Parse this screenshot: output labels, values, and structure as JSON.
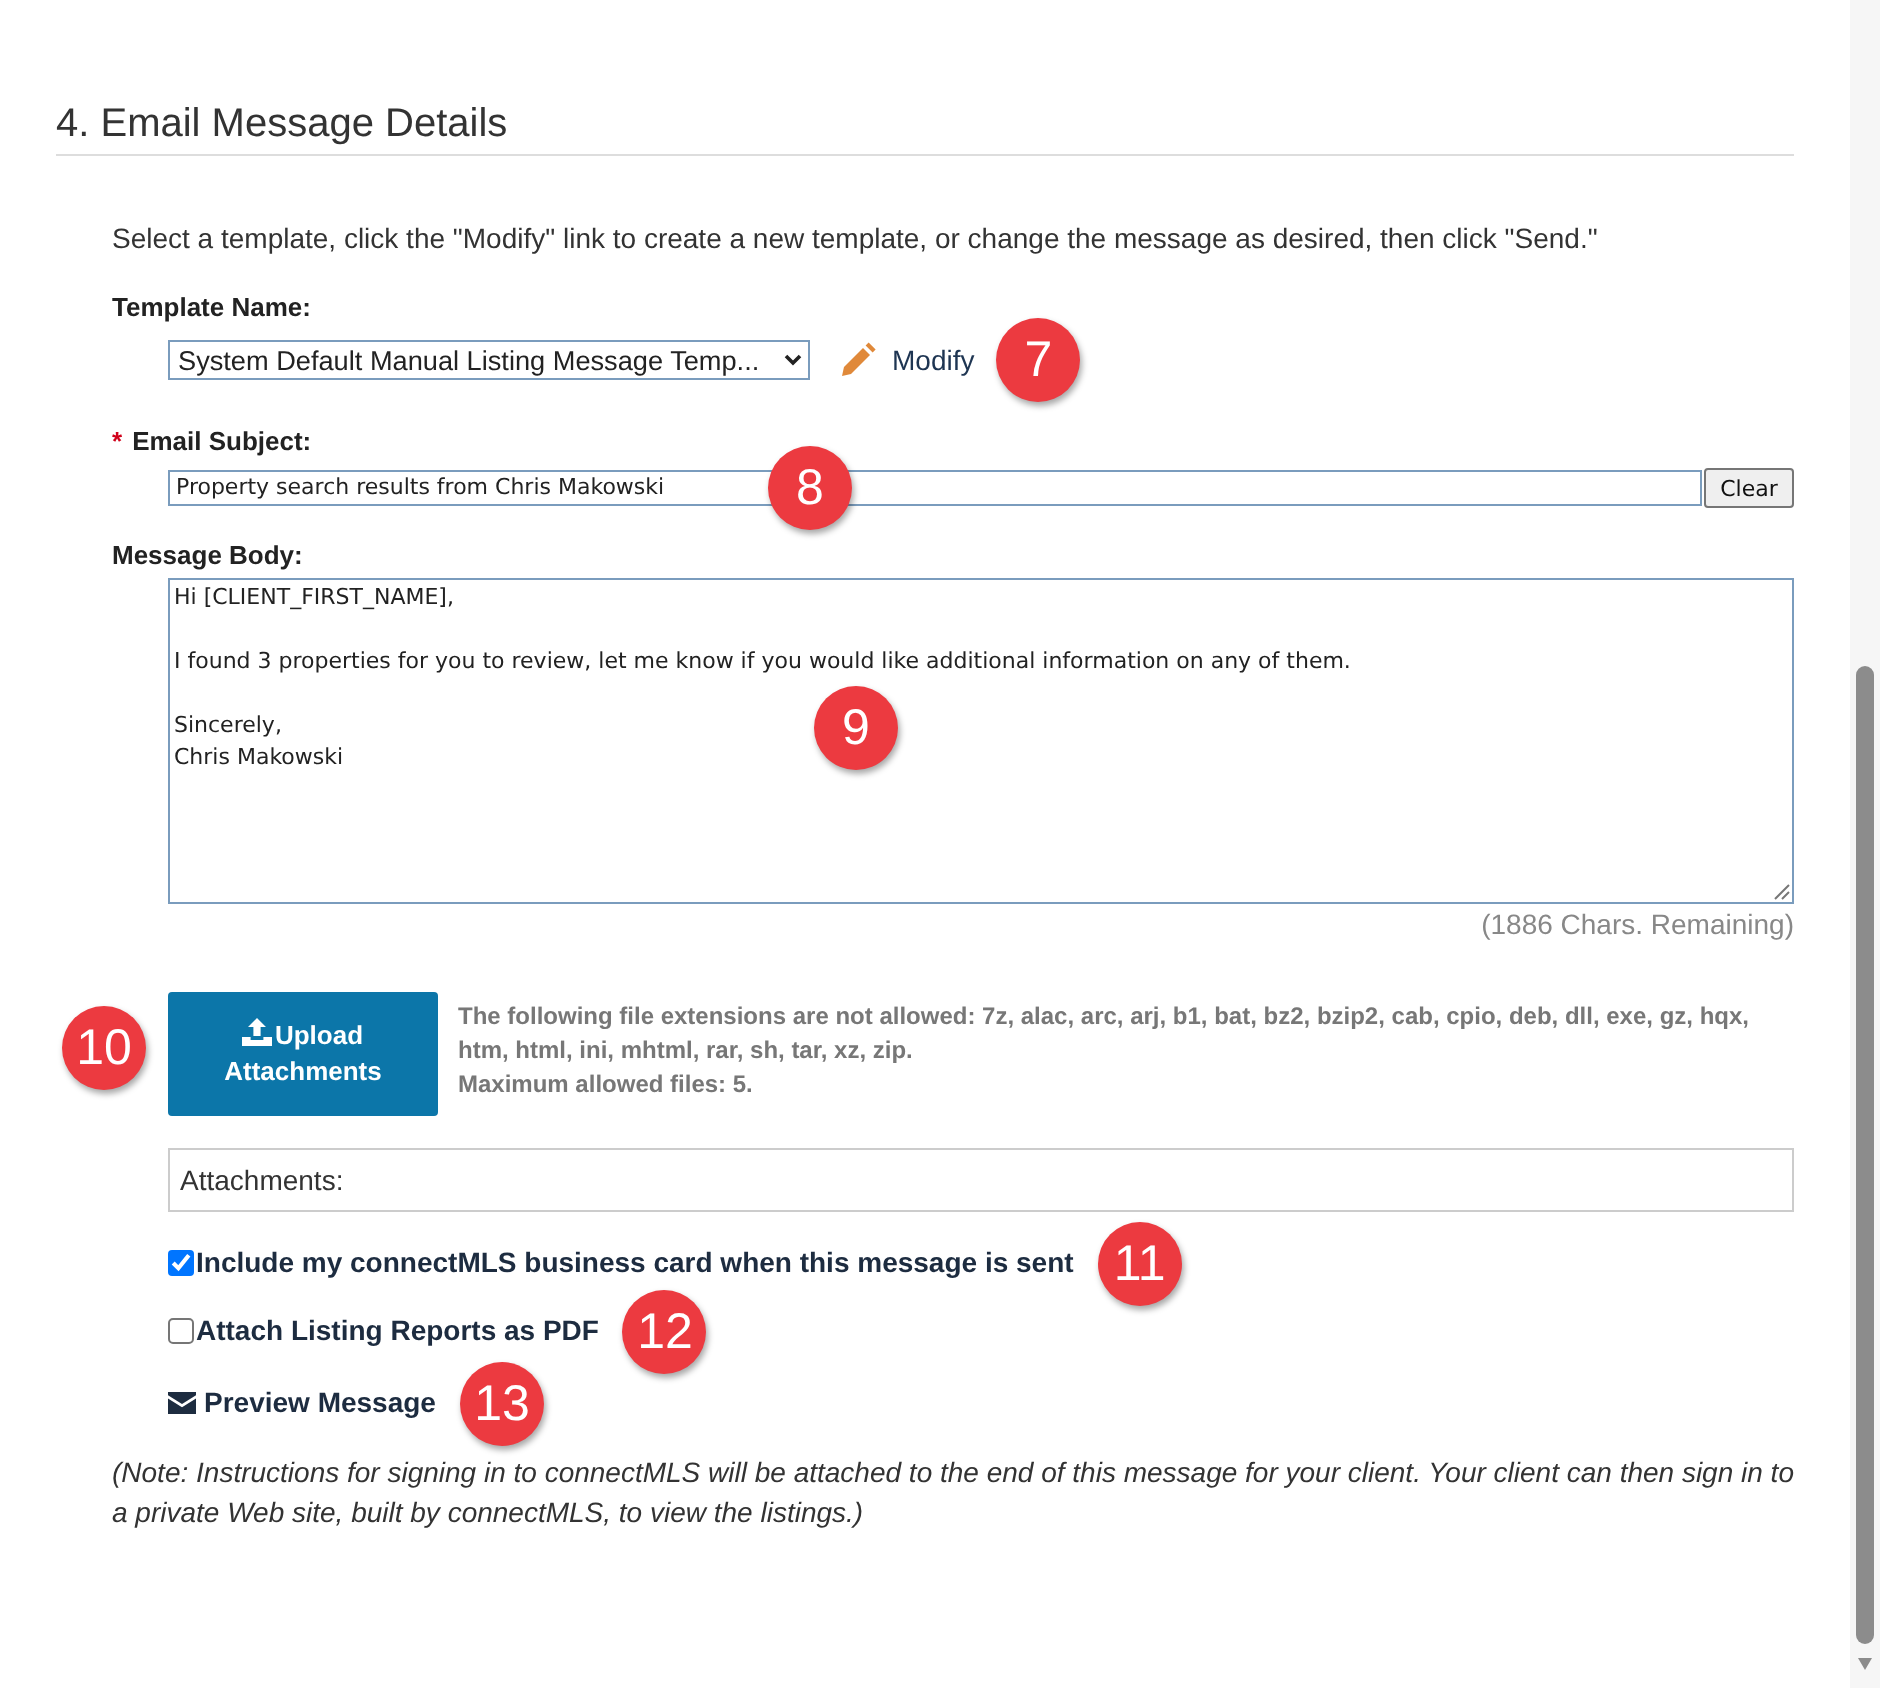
{
  "section": {
    "title": "4. Email Message Details",
    "instructions": "Select a template, click the \"Modify\" link to create a new template, or change the message as desired, then click \"Send.\""
  },
  "template": {
    "label": "Template Name:",
    "value": "System Default Manual Listing Message Temp...",
    "modify_link": "Modify",
    "callout": "7"
  },
  "subject": {
    "required_mark": "*",
    "label": "Email Subject:",
    "value": "Property search results from Chris Makowski",
    "clear_button": "Clear",
    "callout": "8"
  },
  "message_body": {
    "label": "Message Body:",
    "value": "Hi [CLIENT_FIRST_NAME],\n\nI found 3 properties for you to review, let me know if you would like additional information on any of them.\n\nSincerely,\nChris Makowski",
    "callout": "9",
    "remaining": "(1886 Chars. Remaining)"
  },
  "upload": {
    "button": "Upload Attachments",
    "callout": "10",
    "restrictions": "The following file extensions are not allowed: 7z, alac, arc, arj, b1, bat, bz2, bzip2, cab, cpio, deb, dll, exe, gz, hqx, htm, html, ini, mhtml, rar, sh, tar, xz, zip.",
    "max_files": "Maximum allowed files: 5."
  },
  "attachments": {
    "label": "Attachments:"
  },
  "options": [
    {
      "kind": "checkbox",
      "label": "Include my connectMLS business card when this message is sent",
      "checked": true,
      "callout": "11"
    },
    {
      "kind": "checkbox",
      "label": "Attach Listing Reports as PDF",
      "checked": false,
      "callout": "12"
    },
    {
      "kind": "link",
      "label": "Preview Message",
      "callout": "13"
    }
  ],
  "note": "(Note: Instructions for signing in to connectMLS will be attached to the end of this message for your client. Your client can then sign in to a private Web site, built by connectMLS, to view the listings.)"
}
